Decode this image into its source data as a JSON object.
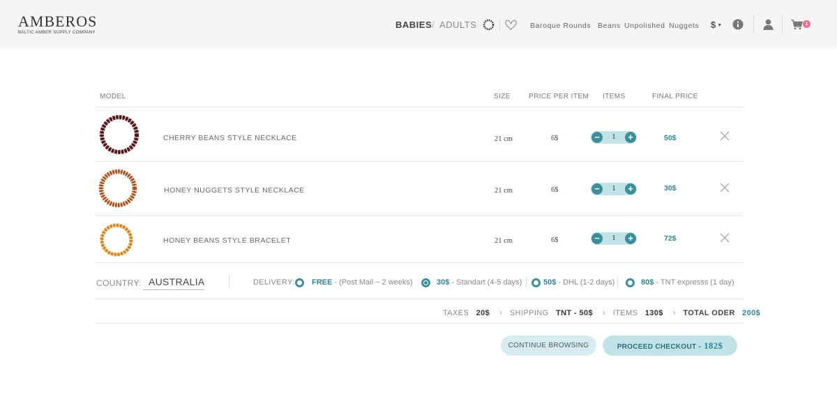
{
  "brand": {
    "name": "AMBEROS",
    "tagline": "BALTIC AMBER SUPPLY COMPANY"
  },
  "nav": {
    "babies": "BABIES",
    "slash": "/",
    "adults": "ADULTS",
    "categories": [
      "Baroque Rounds",
      "Beans",
      "Unpolished",
      "Nuggets"
    ],
    "currency": "$",
    "currency_caret": "▼",
    "cart_count": "1",
    "icons": [
      "ring-icon",
      "heart-icon",
      "info-icon",
      "user-icon",
      "cart-icon"
    ]
  },
  "table": {
    "headers": {
      "model": "MODEL",
      "size": "SIZE",
      "price_per_item": "PRICE PER ITEM",
      "items": "ITEMS",
      "final_price": "FINAL PRICE"
    },
    "rows": [
      {
        "name": "CHERRY BEANS STYLE NECKLACE",
        "size": "21 cm",
        "price": "6$",
        "qty": "1",
        "final": "50$",
        "color": "#5a1a1f",
        "minus": "−",
        "plus": "+"
      },
      {
        "name": "HONEY NUGGETS STYLE NECKLACE",
        "size": "21 cm",
        "price": "6$",
        "qty": "1",
        "final": "30$",
        "color": "#b5521a",
        "minus": "−",
        "plus": "+"
      },
      {
        "name": "HONEY BEANS STYLE BRACELET",
        "size": "21 cm",
        "price": "6$",
        "qty": "1",
        "final": "72$",
        "color": "#e08c1a",
        "minus": "−",
        "plus": "+"
      }
    ]
  },
  "shipping": {
    "country_label": "COUNTRY:",
    "country": "AUSTRALIA",
    "delivery_label": "DELIVERY:",
    "options": [
      {
        "price": "FREE",
        "desc": " - (Post Mail ~ 2 weeks)",
        "selected": false
      },
      {
        "price": "30$",
        "desc": " - Standart (4-5 days)",
        "selected": true
      },
      {
        "price": "50$",
        "desc": " - DHL (1-2 days)",
        "selected": false
      },
      {
        "price": "80$",
        "desc": " - TNT expresss (1 day)",
        "selected": false
      }
    ]
  },
  "totals": {
    "taxes_label": "TAXES",
    "taxes": "20$",
    "shipping_label": "SHIPPING",
    "shipping": "TNT - 50$",
    "items_label": "ITEMS",
    "items": "130$",
    "total_label": "TOTAL ODER",
    "total": "200$",
    "chevron": "›"
  },
  "buttons": {
    "continue": "CONTINUE BROWSING",
    "checkout": "PROCEED CHECKOUT -",
    "checkout_amount": "182$"
  },
  "colors": {
    "accent": "#3a8f99",
    "accent_light": "#bfe3e7",
    "badge": "#f06b8c",
    "header_bg": "#f5f5f5"
  }
}
